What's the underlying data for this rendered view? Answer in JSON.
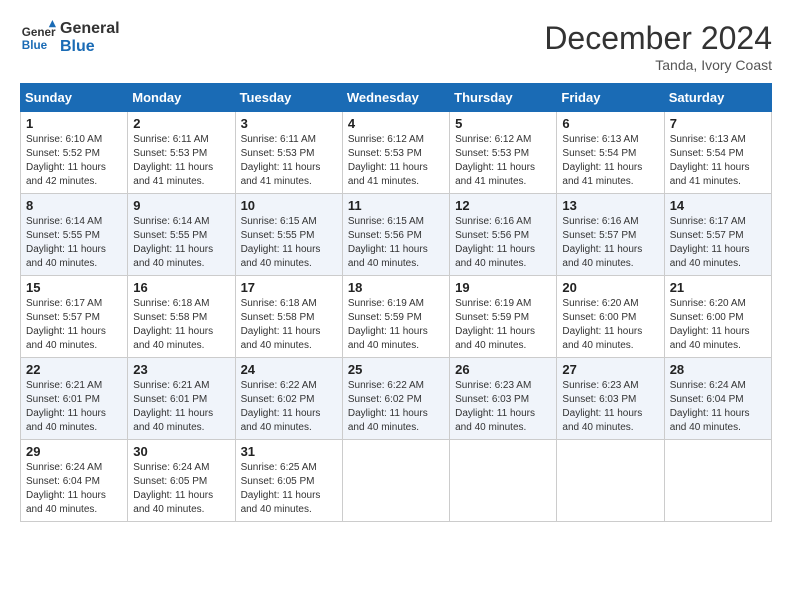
{
  "logo": {
    "line1": "General",
    "line2": "Blue"
  },
  "title": "December 2024",
  "location": "Tanda, Ivory Coast",
  "days_of_week": [
    "Sunday",
    "Monday",
    "Tuesday",
    "Wednesday",
    "Thursday",
    "Friday",
    "Saturday"
  ],
  "weeks": [
    [
      {
        "day": "1",
        "info": "Sunrise: 6:10 AM\nSunset: 5:52 PM\nDaylight: 11 hours\nand 42 minutes."
      },
      {
        "day": "2",
        "info": "Sunrise: 6:11 AM\nSunset: 5:53 PM\nDaylight: 11 hours\nand 41 minutes."
      },
      {
        "day": "3",
        "info": "Sunrise: 6:11 AM\nSunset: 5:53 PM\nDaylight: 11 hours\nand 41 minutes."
      },
      {
        "day": "4",
        "info": "Sunrise: 6:12 AM\nSunset: 5:53 PM\nDaylight: 11 hours\nand 41 minutes."
      },
      {
        "day": "5",
        "info": "Sunrise: 6:12 AM\nSunset: 5:53 PM\nDaylight: 11 hours\nand 41 minutes."
      },
      {
        "day": "6",
        "info": "Sunrise: 6:13 AM\nSunset: 5:54 PM\nDaylight: 11 hours\nand 41 minutes."
      },
      {
        "day": "7",
        "info": "Sunrise: 6:13 AM\nSunset: 5:54 PM\nDaylight: 11 hours\nand 41 minutes."
      }
    ],
    [
      {
        "day": "8",
        "info": "Sunrise: 6:14 AM\nSunset: 5:55 PM\nDaylight: 11 hours\nand 40 minutes."
      },
      {
        "day": "9",
        "info": "Sunrise: 6:14 AM\nSunset: 5:55 PM\nDaylight: 11 hours\nand 40 minutes."
      },
      {
        "day": "10",
        "info": "Sunrise: 6:15 AM\nSunset: 5:55 PM\nDaylight: 11 hours\nand 40 minutes."
      },
      {
        "day": "11",
        "info": "Sunrise: 6:15 AM\nSunset: 5:56 PM\nDaylight: 11 hours\nand 40 minutes."
      },
      {
        "day": "12",
        "info": "Sunrise: 6:16 AM\nSunset: 5:56 PM\nDaylight: 11 hours\nand 40 minutes."
      },
      {
        "day": "13",
        "info": "Sunrise: 6:16 AM\nSunset: 5:57 PM\nDaylight: 11 hours\nand 40 minutes."
      },
      {
        "day": "14",
        "info": "Sunrise: 6:17 AM\nSunset: 5:57 PM\nDaylight: 11 hours\nand 40 minutes."
      }
    ],
    [
      {
        "day": "15",
        "info": "Sunrise: 6:17 AM\nSunset: 5:57 PM\nDaylight: 11 hours\nand 40 minutes."
      },
      {
        "day": "16",
        "info": "Sunrise: 6:18 AM\nSunset: 5:58 PM\nDaylight: 11 hours\nand 40 minutes."
      },
      {
        "day": "17",
        "info": "Sunrise: 6:18 AM\nSunset: 5:58 PM\nDaylight: 11 hours\nand 40 minutes."
      },
      {
        "day": "18",
        "info": "Sunrise: 6:19 AM\nSunset: 5:59 PM\nDaylight: 11 hours\nand 40 minutes."
      },
      {
        "day": "19",
        "info": "Sunrise: 6:19 AM\nSunset: 5:59 PM\nDaylight: 11 hours\nand 40 minutes."
      },
      {
        "day": "20",
        "info": "Sunrise: 6:20 AM\nSunset: 6:00 PM\nDaylight: 11 hours\nand 40 minutes."
      },
      {
        "day": "21",
        "info": "Sunrise: 6:20 AM\nSunset: 6:00 PM\nDaylight: 11 hours\nand 40 minutes."
      }
    ],
    [
      {
        "day": "22",
        "info": "Sunrise: 6:21 AM\nSunset: 6:01 PM\nDaylight: 11 hours\nand 40 minutes."
      },
      {
        "day": "23",
        "info": "Sunrise: 6:21 AM\nSunset: 6:01 PM\nDaylight: 11 hours\nand 40 minutes."
      },
      {
        "day": "24",
        "info": "Sunrise: 6:22 AM\nSunset: 6:02 PM\nDaylight: 11 hours\nand 40 minutes."
      },
      {
        "day": "25",
        "info": "Sunrise: 6:22 AM\nSunset: 6:02 PM\nDaylight: 11 hours\nand 40 minutes."
      },
      {
        "day": "26",
        "info": "Sunrise: 6:23 AM\nSunset: 6:03 PM\nDaylight: 11 hours\nand 40 minutes."
      },
      {
        "day": "27",
        "info": "Sunrise: 6:23 AM\nSunset: 6:03 PM\nDaylight: 11 hours\nand 40 minutes."
      },
      {
        "day": "28",
        "info": "Sunrise: 6:24 AM\nSunset: 6:04 PM\nDaylight: 11 hours\nand 40 minutes."
      }
    ],
    [
      {
        "day": "29",
        "info": "Sunrise: 6:24 AM\nSunset: 6:04 PM\nDaylight: 11 hours\nand 40 minutes."
      },
      {
        "day": "30",
        "info": "Sunrise: 6:24 AM\nSunset: 6:05 PM\nDaylight: 11 hours\nand 40 minutes."
      },
      {
        "day": "31",
        "info": "Sunrise: 6:25 AM\nSunset: 6:05 PM\nDaylight: 11 hours\nand 40 minutes."
      },
      null,
      null,
      null,
      null
    ]
  ]
}
